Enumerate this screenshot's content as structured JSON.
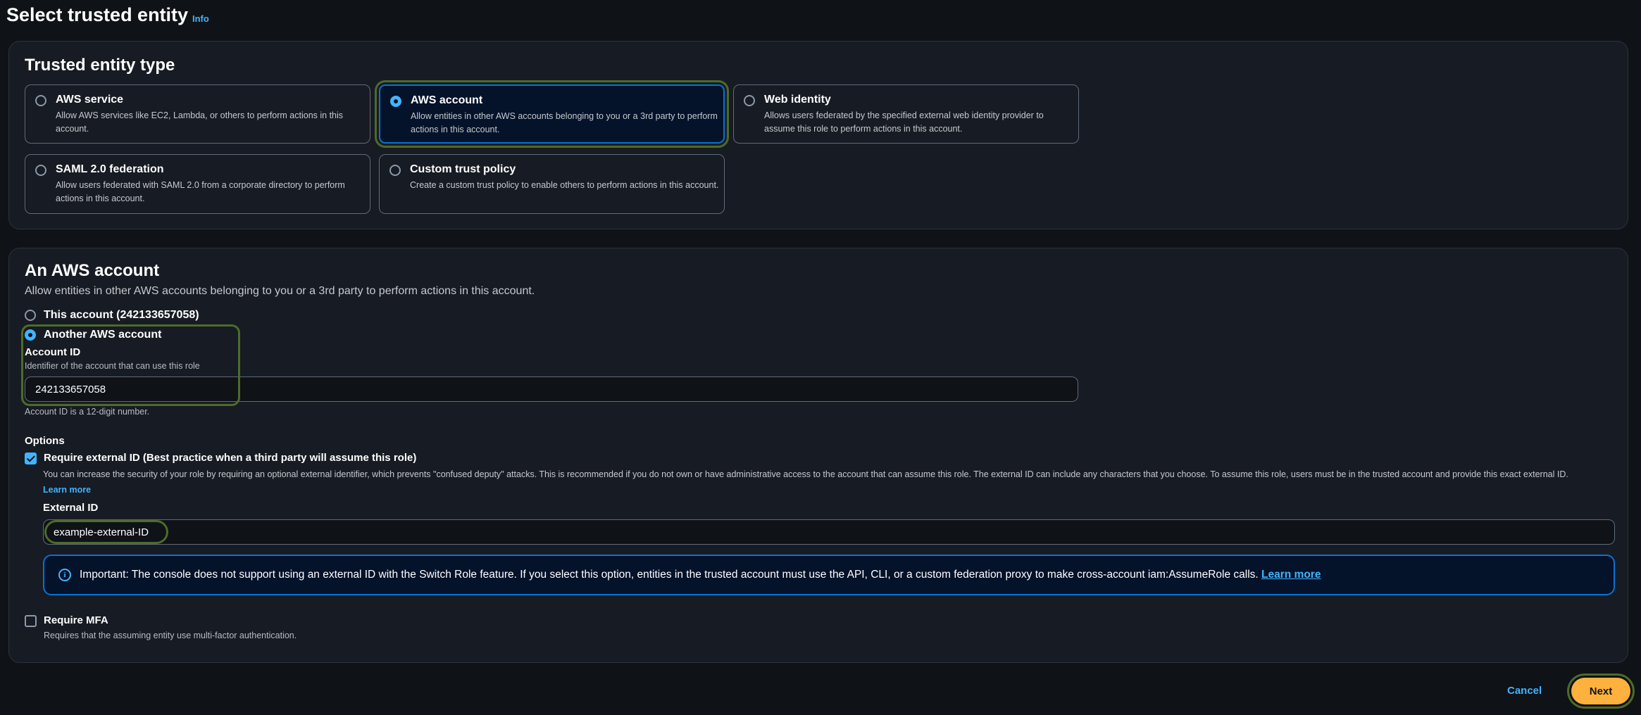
{
  "header": {
    "title": "Select trusted entity",
    "info_link": "Info"
  },
  "trusted_entity_type": {
    "title": "Trusted entity type",
    "options": [
      {
        "label": "AWS service",
        "description": "Allow AWS services like EC2, Lambda, or others to perform actions in this account.",
        "selected": false
      },
      {
        "label": "AWS account",
        "description": "Allow entities in other AWS accounts belonging to you or a 3rd party to perform actions in this account.",
        "selected": true
      },
      {
        "label": "Web identity",
        "description": "Allows users federated by the specified external web identity provider to assume this role to perform actions in this account.",
        "selected": false
      },
      {
        "label": "SAML 2.0 federation",
        "description": "Allow users federated with SAML 2.0 from a corporate directory to perform actions in this account.",
        "selected": false
      },
      {
        "label": "Custom trust policy",
        "description": "Create a custom trust policy to enable others to perform actions in this account.",
        "selected": false
      }
    ]
  },
  "aws_account": {
    "title": "An AWS account",
    "description": "Allow entities in other AWS accounts belonging to you or a 3rd party to perform actions in this account.",
    "this_account_label": "This account (242133657058)",
    "another_account_label": "Another AWS account",
    "account_id_label": "Account ID",
    "account_id_description": "Identifier of the account that can use this role",
    "account_id_value": "242133657058",
    "account_id_hint": "Account ID is a 12-digit number.",
    "options_label": "Options",
    "require_external_id_label": "Require external ID (Best practice when a third party will assume this role)",
    "require_external_id_checked": true,
    "require_external_id_description": "You can increase the security of your role by requiring an optional external identifier, which prevents \"confused deputy\" attacks. This is recommended if you do not own or have administrative access to the account that can assume this role. The external ID can include any characters that you choose. To assume this role, users must be in the trusted account and provide this exact external ID.",
    "learn_more": "Learn more",
    "external_id_label": "External ID",
    "external_id_value": "example-external-ID",
    "alert_text": "Important: The console does not support using an external ID with the Switch Role feature. If you select this option, entities in the trusted account must use the API, CLI, or a custom federation proxy to make cross-account iam:AssumeRole calls.",
    "alert_link": "Learn more",
    "require_mfa_label": "Require MFA",
    "require_mfa_checked": false,
    "require_mfa_description": "Requires that the assuming entity use multi-factor authentication."
  },
  "footer": {
    "cancel_label": "Cancel",
    "next_label": "Next"
  },
  "colors": {
    "accent": "#42b4ff",
    "primary_button": "#ffb13d",
    "highlight": "#4d6b2a"
  }
}
